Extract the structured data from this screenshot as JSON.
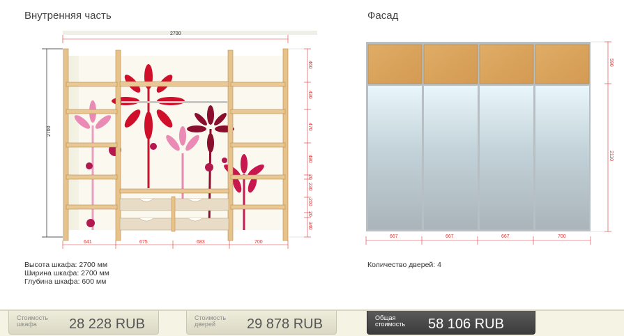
{
  "inner": {
    "title": "Внутренняя часть",
    "width_dim": "2700",
    "height_dim": "2700",
    "shelf_dims": [
      "460",
      "430",
      "470",
      "480",
      "20",
      "230",
      "200",
      "20",
      "340"
    ],
    "bottom_dims": [
      "641",
      "675",
      "683",
      "700"
    ]
  },
  "facade": {
    "title": "Фасад",
    "top_dim": "590",
    "mirror_dim": "2110",
    "bottom_dims": [
      "667",
      "667",
      "667",
      "700"
    ]
  },
  "specs": {
    "height": "Высота шкафа: 2700 мм",
    "width": "Ширина шкафа: 2700 мм",
    "depth": "Глубина шкафа: 600 мм"
  },
  "doors": "Количество дверей: 4",
  "prices": {
    "wardrobe_label_1": "Стоимость",
    "wardrobe_label_2": "шкафа",
    "wardrobe_value": "28 228  RUB",
    "doors_label_1": "Стоимость",
    "doors_label_2": "дверей",
    "doors_value": "29 878  RUB",
    "total_label_1": "Общая",
    "total_label_2": "стоимость",
    "total_value": "58 106  RUB"
  },
  "colors": {
    "wood": "#e8c48c",
    "accent_red": "#d12033",
    "mirror": "#c9dbe2",
    "dim_red": "#d33333"
  }
}
